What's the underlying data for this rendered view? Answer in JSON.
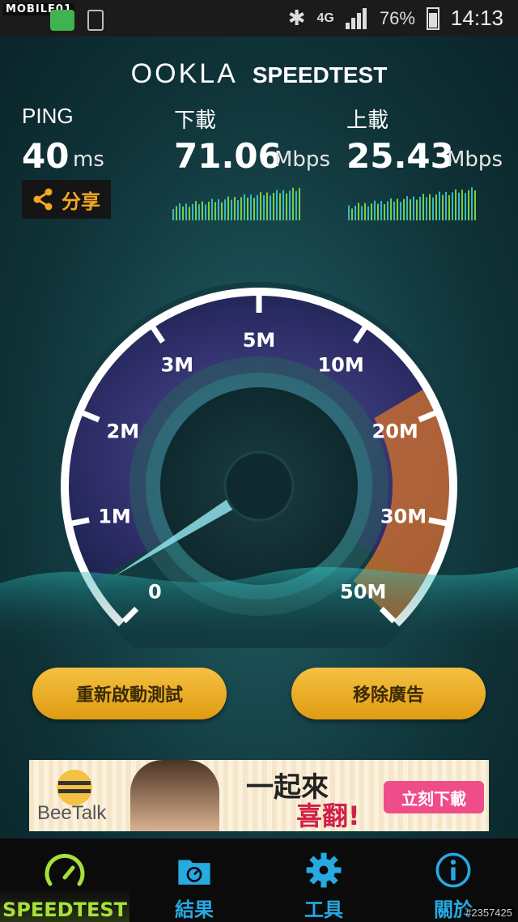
{
  "status_bar": {
    "watermark": "MOBILE01",
    "network": "4G",
    "battery": "76%",
    "time": "14:13"
  },
  "header": {
    "brand": "OOKLA",
    "product": "SPEEDTEST"
  },
  "metrics": {
    "ping": {
      "label": "PING",
      "value": "40",
      "unit": "ms"
    },
    "download": {
      "label": "下載",
      "value": "71.06",
      "unit": "Mbps"
    },
    "upload": {
      "label": "上載",
      "value": "25.43",
      "unit": "Mbps"
    }
  },
  "share_button": {
    "label": "分享"
  },
  "gauge": {
    "ticks": [
      "0",
      "1M",
      "2M",
      "3M",
      "5M",
      "10M",
      "20M",
      "30M",
      "50M"
    ]
  },
  "buttons": {
    "restart": "重新啟動測試",
    "remove_ads": "移除廣告"
  },
  "ad": {
    "brand": "BeeTalk",
    "headline": "一起來",
    "headline2": "喜翻!",
    "cta": "立刻下載"
  },
  "tabs": [
    {
      "label": "SPEEDTEST",
      "icon": "speedometer-icon"
    },
    {
      "label": "結果",
      "icon": "folder-icon"
    },
    {
      "label": "工具",
      "icon": "gear-icon"
    },
    {
      "label": "關於",
      "icon": "info-icon"
    }
  ],
  "credit": "#2357425",
  "colors": {
    "accent_green": "#a6e13a",
    "accent_blue": "#27a9e1",
    "button_gold": "#f0b12c",
    "gauge_orange": "#d9742a"
  }
}
